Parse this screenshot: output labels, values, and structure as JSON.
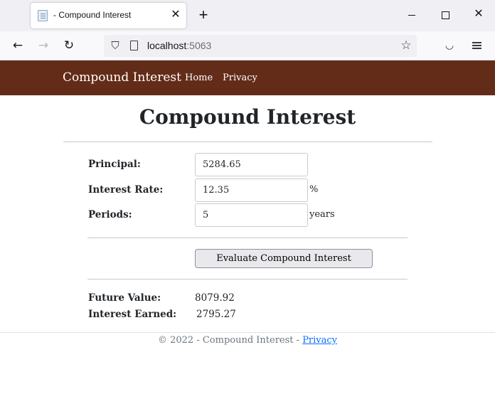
{
  "browser": {
    "tab_title": "- Compound Interest",
    "tab_close": "✕",
    "new_tab": "+",
    "url_host": "localhost",
    "url_port": ":5063"
  },
  "navbar": {
    "brand": "Compound Interest",
    "links": [
      "Home",
      "Privacy"
    ]
  },
  "main": {
    "title": "Compound Interest",
    "fields": [
      {
        "label": "Principal:",
        "value": "5284.65",
        "suffix": ""
      },
      {
        "label": "Interest Rate:",
        "value": "12.35",
        "suffix": "%"
      },
      {
        "label": "Periods:",
        "value": "5",
        "suffix": "years"
      }
    ],
    "evaluate_label": "Evaluate Compound Interest",
    "results": [
      {
        "label": "Future Value:",
        "value": "8079.92"
      },
      {
        "label": "Interest Earned:",
        "value": "2795.27"
      }
    ]
  },
  "footer": {
    "text": "© 2022 - Compound Interest - ",
    "link": "Privacy"
  }
}
